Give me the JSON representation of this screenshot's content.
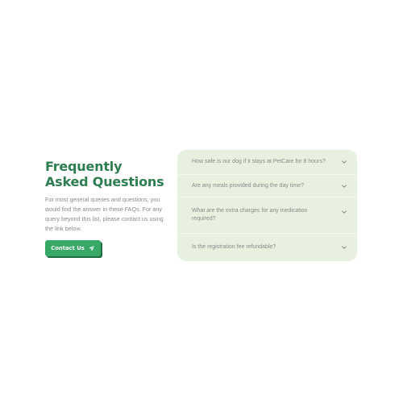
{
  "intro": {
    "title": "Frequently Asked Questions",
    "description": "For most general queries and questions, you would find the answer in these FAQs. For any query beyond this list, please contact us using the link below.",
    "contact_label": "Contact Us"
  },
  "faq": {
    "items": [
      {
        "question": "How safe is our dog if it stays at PetCare for 8 hours?"
      },
      {
        "question": "Are any meals provided during the day time?"
      },
      {
        "question": "What are the extra charges for any medication required?"
      },
      {
        "question": "Is the registration fee refundable?"
      }
    ]
  },
  "colors": {
    "accent": "#38a867",
    "heading": "#2e7d4f",
    "panel": "#e8f0e0",
    "text": "#8a8a8a"
  },
  "icons": {
    "button": "paper-plane-icon",
    "faq_toggle": "chevron-down-icon"
  }
}
